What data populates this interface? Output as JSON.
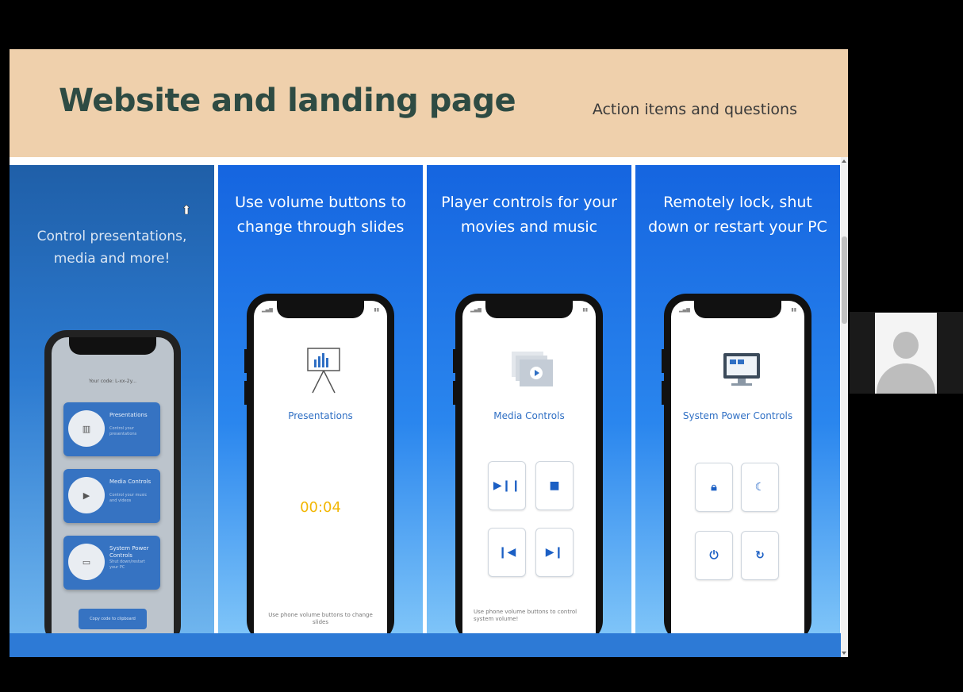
{
  "slide": {
    "title": "Website and landing page",
    "subtitle": "Action items and questions"
  },
  "panels": [
    {
      "caption": "Control presentations, media and more!",
      "phone": {
        "top_text": "Your code: L-xx-2y...",
        "cards": [
          {
            "title": "Presentations",
            "sub": "Control your presentations"
          },
          {
            "title": "Media Controls",
            "sub": "Control your music and videos"
          },
          {
            "title": "System Power Controls",
            "sub": "Shut down/restart your PC"
          }
        ],
        "copy_button": "Copy code to clipboard"
      }
    },
    {
      "caption": "Use volume buttons to change through slides",
      "app_label": "Presentations",
      "timer": "00:04",
      "footnote": "Use phone volume buttons to change slides"
    },
    {
      "caption": "Player controls for your movies and music",
      "app_label": "Media Controls",
      "buttons": [
        "play-pause",
        "stop",
        "previous",
        "next"
      ],
      "footnote": "Use phone volume buttons to control system volume!"
    },
    {
      "caption": "Remotely lock, shut down or restart your PC",
      "app_label": "System Power Controls",
      "buttons": [
        "lock",
        "sleep",
        "power",
        "restart"
      ]
    }
  ],
  "colors": {
    "header_bg": "#efd0ac",
    "title": "#2e4b43",
    "panel_blue": "#1565e0",
    "timer": "#f2b705"
  }
}
